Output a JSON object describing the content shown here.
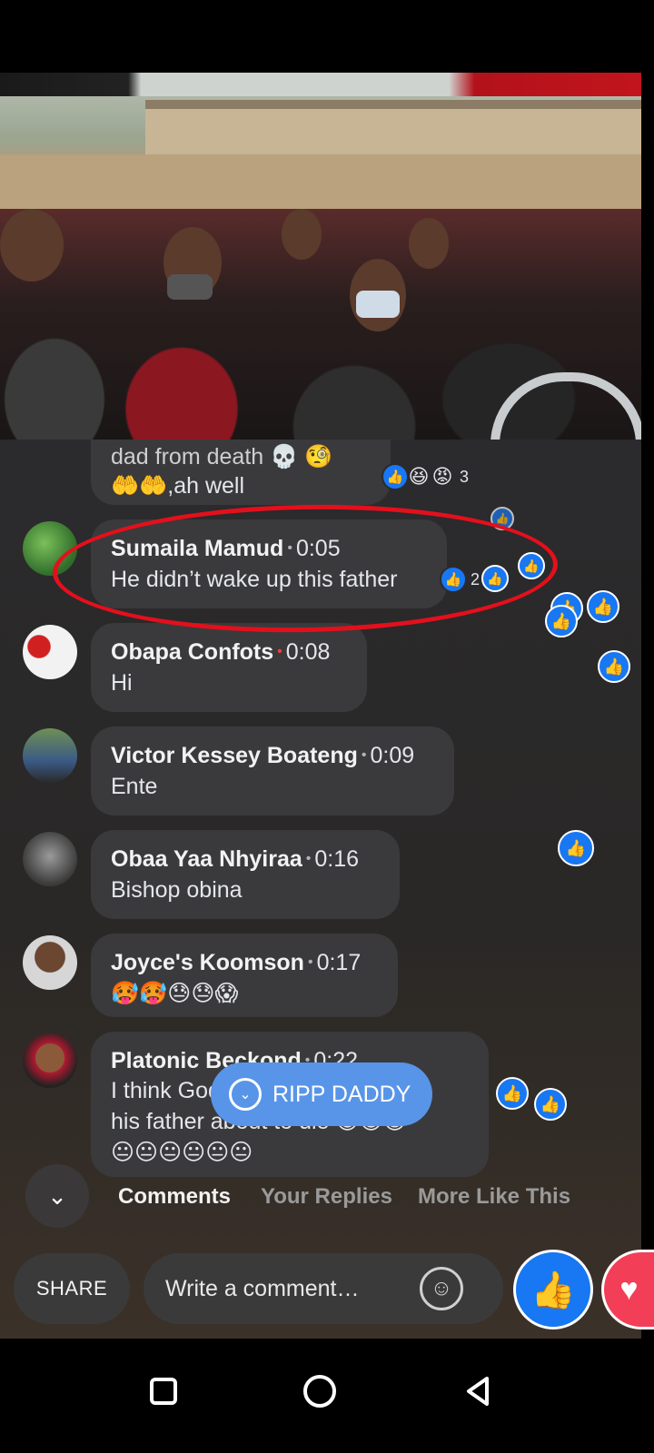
{
  "video": {
    "description_icon": "funeral-crowd-video"
  },
  "comments": [
    {
      "author": "",
      "time": "",
      "text_line1": "dad from death 💀 🧐",
      "text_line2": "🤲🤲,ah well",
      "reaction_count": "3"
    },
    {
      "author": "Sumaila Mamud",
      "time": "0:05",
      "text": "He didn’t wake up this father",
      "reaction_count": "2"
    },
    {
      "author": "Obapa Confots",
      "time": "0:08",
      "text": "Hi"
    },
    {
      "author": "Victor Kessey Boateng",
      "time": "0:09",
      "text": "Ente"
    },
    {
      "author": "Obaa Yaa Nhyiraa",
      "time": "0:16",
      "text": "Bishop obina"
    },
    {
      "author": "Joyce's Koomson",
      "time": "0:17",
      "text": "🥵🥵😓😓😱"
    },
    {
      "author": "Platonic Beckond",
      "time": "0:22",
      "text_line1": "I think God wanted to make",
      "text_line2": "his father about to die 😅😅😀",
      "text_line3": "😐😐😐😐😐😐"
    }
  ],
  "new_comments_pill": {
    "label": "RIPP DADDY"
  },
  "tabs": [
    {
      "label": "Comments",
      "active": true
    },
    {
      "label": "Your Replies",
      "active": false
    },
    {
      "label": "More Like This",
      "active": false
    }
  ],
  "bottom_bar": {
    "share_label": "SHARE",
    "comment_placeholder": "Write a comment…"
  },
  "colors": {
    "accent": "#1877f2",
    "highlight_circle": "#e3101c",
    "pill": "#5895e8",
    "love": "#f33e58"
  },
  "icons": [
    "like-icon",
    "haha-icon",
    "angry-icon",
    "chevron-down-icon",
    "emoji-icon",
    "heart-icon",
    "home-icon",
    "back-icon",
    "recents-icon"
  ]
}
